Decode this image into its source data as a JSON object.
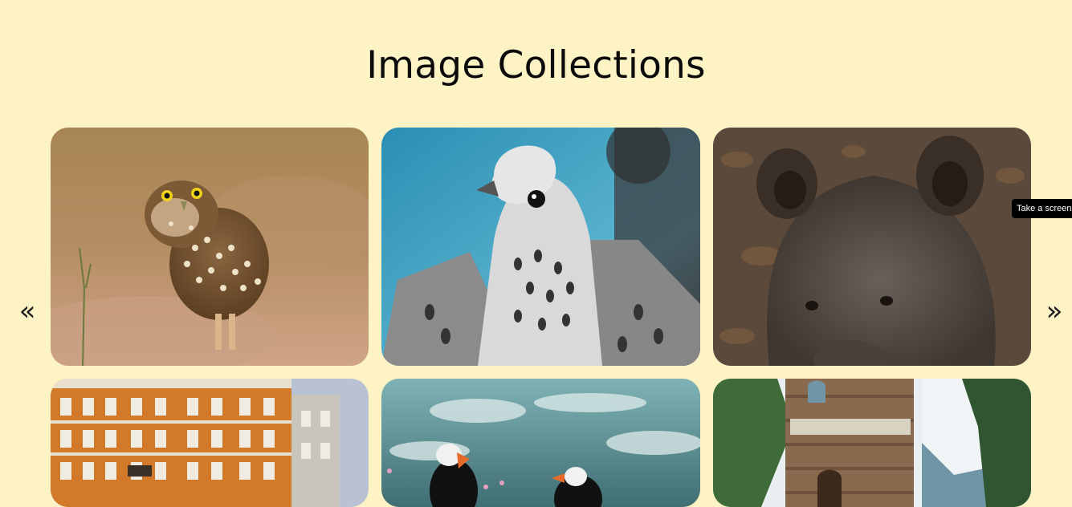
{
  "page": {
    "title": "Image Collections"
  },
  "carousel": {
    "prev_label": "«",
    "next_label": "»"
  },
  "tooltip": {
    "text": "Take a screen"
  },
  "images": [
    {
      "subject": "burrowing owl"
    },
    {
      "subject": "falcon"
    },
    {
      "subject": "brown bear"
    },
    {
      "subject": "orange apartment building"
    },
    {
      "subject": "puffins"
    },
    {
      "subject": "stone castle"
    }
  ],
  "colors": {
    "background": "#fef3c4",
    "title": "#0b0b0b"
  }
}
